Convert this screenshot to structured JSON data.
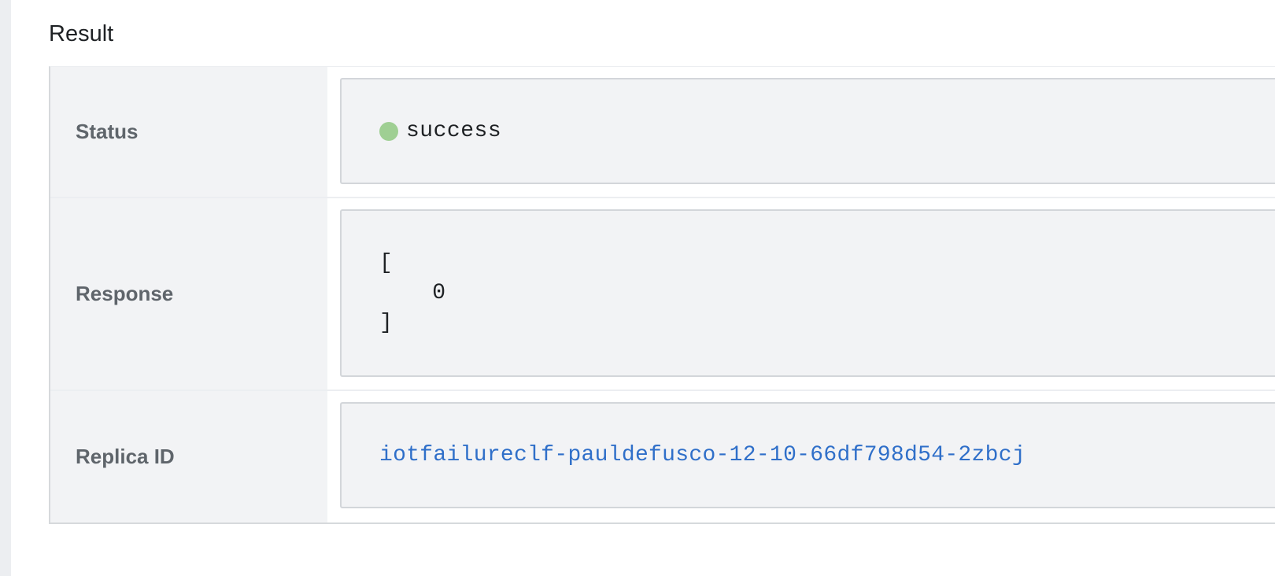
{
  "section": {
    "title": "Result"
  },
  "rows": {
    "status": {
      "label": "Status",
      "value": "success",
      "indicator_color": "#9fcf93"
    },
    "response": {
      "label": "Response",
      "value": "[\n    0\n]"
    },
    "replica": {
      "label": "Replica ID",
      "value": "iotfailureclf-pauldefusco-12-10-66df798d54-2zbcj",
      "link_color": "#2f6fc9"
    }
  }
}
